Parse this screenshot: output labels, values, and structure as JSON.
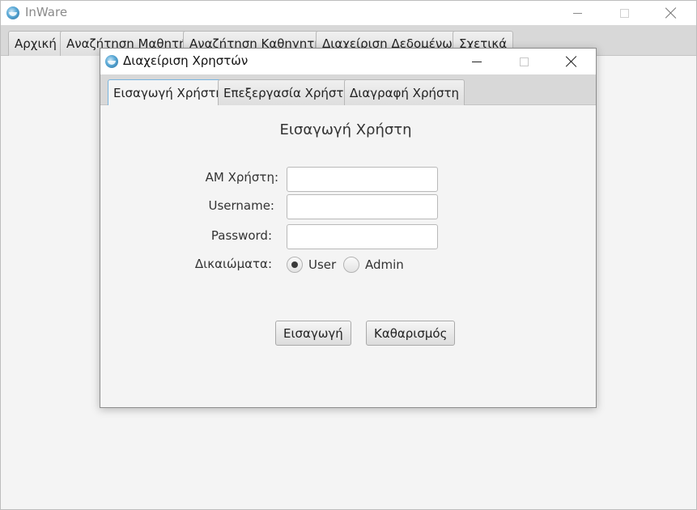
{
  "app": {
    "title": "InWare",
    "menu_tabs": [
      {
        "label": "Αρχική"
      },
      {
        "label": "Αναζήτηση Μαθητή"
      },
      {
        "label": "Αναζήτηση Καθηγητή"
      },
      {
        "label": "Διαχείριση Δεδομένων"
      },
      {
        "label": "Σχετικά"
      }
    ]
  },
  "dialog": {
    "title": "Διαχείριση Χρηστών",
    "tabs": [
      {
        "label": "Εισαγωγή Χρήστη",
        "selected": true
      },
      {
        "label": "Επεξεργασία Χρήστη",
        "selected": false
      },
      {
        "label": "Διαγραφή Χρήστη",
        "selected": false
      }
    ],
    "form": {
      "heading": "Εισαγωγή Χρήστη",
      "am_label": "AM Χρήστη:",
      "am_value": "",
      "username_label": "Username:",
      "username_value": "",
      "password_label": "Password:",
      "password_value": "",
      "rights_label": "Δικαιώματα:",
      "rights_options": [
        {
          "label": "User",
          "checked": true
        },
        {
          "label": "Admin",
          "checked": false
        }
      ],
      "insert_button": "Εισαγωγή",
      "clear_button": "Καθαρισμός"
    }
  },
  "icons": {
    "app_icon": "inware-logo-icon",
    "minimize": "minimize-icon",
    "maximize": "maximize-icon",
    "close": "close-icon"
  }
}
